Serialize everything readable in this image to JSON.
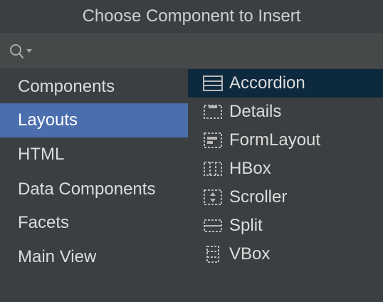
{
  "dialog": {
    "title": "Choose Component to Insert"
  },
  "search": {
    "icon": "search-icon",
    "value": "",
    "placeholder": ""
  },
  "categories": [
    {
      "label": "Components",
      "selected": false
    },
    {
      "label": "Layouts",
      "selected": true
    },
    {
      "label": "HTML",
      "selected": false
    },
    {
      "label": "Data Components",
      "selected": false
    },
    {
      "label": "Facets",
      "selected": false
    },
    {
      "label": "Main View",
      "selected": false
    }
  ],
  "components": [
    {
      "label": "Accordion",
      "icon": "accordion-icon",
      "selected": true
    },
    {
      "label": "Details",
      "icon": "details-icon",
      "selected": false
    },
    {
      "label": "FormLayout",
      "icon": "formlayout-icon",
      "selected": false
    },
    {
      "label": "HBox",
      "icon": "hbox-icon",
      "selected": false
    },
    {
      "label": "Scroller",
      "icon": "scroller-icon",
      "selected": false
    },
    {
      "label": "Split",
      "icon": "split-icon",
      "selected": false
    },
    {
      "label": "VBox",
      "icon": "vbox-icon",
      "selected": false
    }
  ],
  "colors": {
    "background": "#3c3f41",
    "search_background": "#45494a",
    "category_selected": "#4b6eaf",
    "component_selected": "#0d293e",
    "text": "#dcdcdc"
  }
}
